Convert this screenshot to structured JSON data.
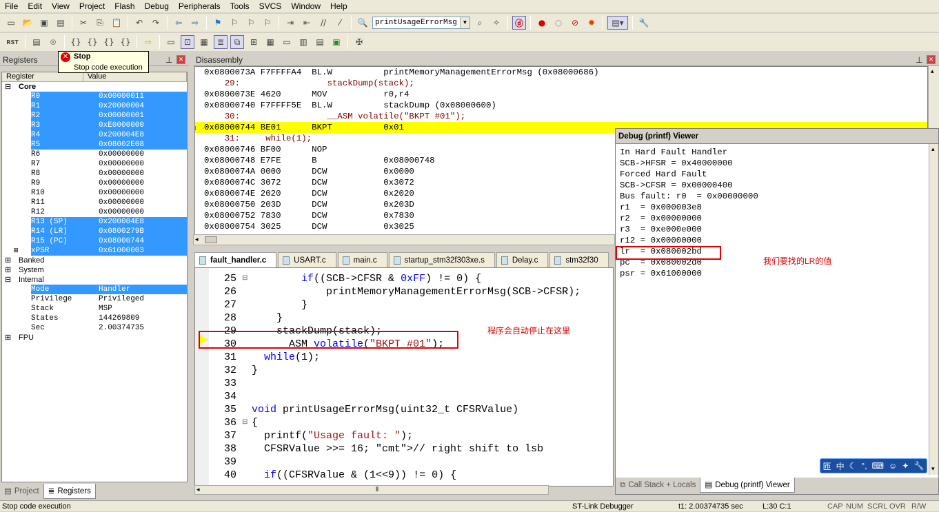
{
  "menu": [
    "File",
    "Edit",
    "View",
    "Project",
    "Flash",
    "Debug",
    "Peripherals",
    "Tools",
    "SVCS",
    "Window",
    "Help"
  ],
  "toolbar": {
    "function_combo": "printUsageErrorMsg",
    "rst_label": "RST"
  },
  "tooltip": {
    "title": "Stop",
    "desc": "Stop code execution"
  },
  "registers": {
    "title": "Registers",
    "col_register": "Register",
    "col_value": "Value",
    "core_label": "Core",
    "core": [
      {
        "name": "R0",
        "value": "0x00000011",
        "sel": true
      },
      {
        "name": "R1",
        "value": "0x20000004",
        "sel": true
      },
      {
        "name": "R2",
        "value": "0x00000001",
        "sel": true
      },
      {
        "name": "R3",
        "value": "0xE0000000",
        "sel": true
      },
      {
        "name": "R4",
        "value": "0x200004E8",
        "sel": true
      },
      {
        "name": "R5",
        "value": "0x08002E08",
        "sel": true
      },
      {
        "name": "R6",
        "value": "0x00000000",
        "sel": false
      },
      {
        "name": "R7",
        "value": "0x00000000",
        "sel": false
      },
      {
        "name": "R8",
        "value": "0x00000000",
        "sel": false
      },
      {
        "name": "R9",
        "value": "0x00000000",
        "sel": false
      },
      {
        "name": "R10",
        "value": "0x00000000",
        "sel": false
      },
      {
        "name": "R11",
        "value": "0x00000000",
        "sel": false
      },
      {
        "name": "R12",
        "value": "0x00000000",
        "sel": false
      },
      {
        "name": "R13 (SP)",
        "value": "0x200004E8",
        "sel": true
      },
      {
        "name": "R14 (LR)",
        "value": "0x0800279B",
        "sel": true
      },
      {
        "name": "R15 (PC)",
        "value": "0x08000744",
        "sel": true
      },
      {
        "name": "xPSR",
        "value": "0x61000003",
        "sel": true
      }
    ],
    "groups": [
      "Banked",
      "System",
      "Internal"
    ],
    "internal": [
      {
        "name": "Mode",
        "value": "Handler",
        "sel": true
      },
      {
        "name": "Privilege",
        "value": "Privileged",
        "sel": false
      },
      {
        "name": "Stack",
        "value": "MSP",
        "sel": false
      },
      {
        "name": "States",
        "value": "144269809",
        "sel": false
      },
      {
        "name": "Sec",
        "value": "2.00374735",
        "sel": false
      }
    ],
    "fpu_label": "FPU"
  },
  "left_tabs": {
    "project": "Project",
    "registers": "Registers"
  },
  "disassembly": {
    "title": "Disassembly",
    "lines": [
      {
        "t": "0x0800073A F7FFFFA4  BL.W          printMemoryManagementErrorMsg (0x08000686)",
        "k": "asm"
      },
      {
        "t": "    29:                 stackDump(stack);",
        "k": "src"
      },
      {
        "t": "0x0800073E 4620      MOV           r0,r4",
        "k": "asm"
      },
      {
        "t": "0x08000740 F7FFFF5E  BL.W          stackDump (0x08000600)",
        "k": "asm"
      },
      {
        "t": "    30:                 __ASM volatile(\"BKPT #01\");",
        "k": "src"
      },
      {
        "t": "0x08000744 BE01      BKPT          0x01",
        "k": "cur"
      },
      {
        "t": "    31:     while(1);",
        "k": "src"
      },
      {
        "t": "0x08000746 BF00      NOP",
        "k": "asm"
      },
      {
        "t": "0x08000748 E7FE      B             0x08000748",
        "k": "asm"
      },
      {
        "t": "0x0800074A 0000      DCW           0x0000",
        "k": "asm"
      },
      {
        "t": "0x0800074C 3072      DCW           0x3072",
        "k": "asm"
      },
      {
        "t": "0x0800074E 2020      DCW           0x2020",
        "k": "asm"
      },
      {
        "t": "0x08000750 203D      DCW           0x203D",
        "k": "asm"
      },
      {
        "t": "0x08000752 7830      DCW           0x7830",
        "k": "asm"
      },
      {
        "t": "0x08000754 3025      DCW           0x3025",
        "k": "asm"
      }
    ]
  },
  "tabs": [
    "fault_handler.c",
    "USART.c",
    "main.c",
    "startup_stm32f303xe.s",
    "Delay.c",
    "stm32f30"
  ],
  "editor": {
    "lines": [
      {
        "n": "25",
        "c": "        if((SCB->CFSR & 0xFF) != 0) {"
      },
      {
        "n": "26",
        "c": "            printMemoryManagementErrorMsg(SCB->CFSR);"
      },
      {
        "n": "27",
        "c": "        }"
      },
      {
        "n": "28",
        "c": "    }"
      },
      {
        "n": "29",
        "c": "    stackDump(stack);"
      },
      {
        "n": "30",
        "c": "    __ASM volatile(\"BKPT #01\");"
      },
      {
        "n": "31",
        "c": "  while(1);"
      },
      {
        "n": "32",
        "c": "}"
      },
      {
        "n": "33",
        "c": ""
      },
      {
        "n": "34",
        "c": ""
      },
      {
        "n": "35",
        "c": "void printUsageErrorMsg(uint32_t CFSRValue)"
      },
      {
        "n": "36",
        "c": "{"
      },
      {
        "n": "37",
        "c": "  printf(\"Usage fault: \");"
      },
      {
        "n": "38",
        "c": "  CFSRValue >>= 16; // right shift to lsb"
      },
      {
        "n": "39",
        "c": ""
      },
      {
        "n": "40",
        "c": "  if((CFSRValue & (1<<9)) != 0) {"
      }
    ],
    "annotation": "程序会自动停止在这里"
  },
  "viewer": {
    "title": "Debug (printf) Viewer",
    "lines": [
      "In Hard Fault Handler",
      "SCB->HFSR = 0x40000000",
      "Forced Hard Fault",
      "SCB->CFSR = 0x00000400",
      "Bus fault: r0  = 0x00000000",
      "r1  = 0x000003e8",
      "r2  = 0x00000000",
      "r3  = 0xe000e000",
      "r12 = 0x00000000",
      "lr  = 0x080002bd",
      "pc  = 0x080002d0",
      "psr = 0x61000000"
    ],
    "annotation": "我们要找的LR的值",
    "bottom_tabs": [
      "Call Stack + Locals",
      "Debug (printf) Viewer"
    ]
  },
  "status": {
    "left": "Stop code execution",
    "debugger": "ST-Link Debugger",
    "time": "t1: 2.00374735 sec",
    "pos": "L:30 C:1",
    "keys": [
      "CAP",
      "NUM",
      "SCRL",
      "OVR",
      "R/W"
    ]
  },
  "colors": {
    "selection": "#3399ff",
    "current_line": "#ffff00",
    "annotation": "#e00000"
  }
}
